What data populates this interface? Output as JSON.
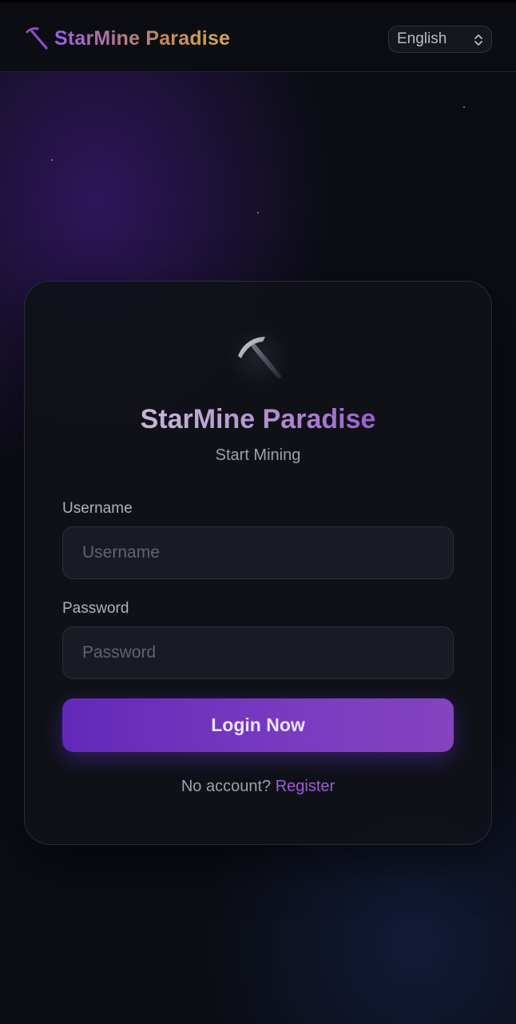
{
  "header": {
    "brand_name": "StarMine Paradise",
    "brand_icon": "pickaxe-icon",
    "language": {
      "selected": "English",
      "icon": "chevron-up-down-icon"
    }
  },
  "login_card": {
    "logo_icon": "pickaxe-icon",
    "title": "StarMine Paradise",
    "subtitle": "Start Mining",
    "username": {
      "label": "Username",
      "placeholder": "Username",
      "value": ""
    },
    "password": {
      "label": "Password",
      "placeholder": "Password",
      "value": ""
    },
    "submit_label": "Login Now",
    "register_prompt": "No account?",
    "register_link": "Register"
  },
  "colors": {
    "accent_purple": "#7c3aed",
    "brand_gold": "#d9a84e",
    "background": "#0b0d14",
    "card": "#101118"
  }
}
